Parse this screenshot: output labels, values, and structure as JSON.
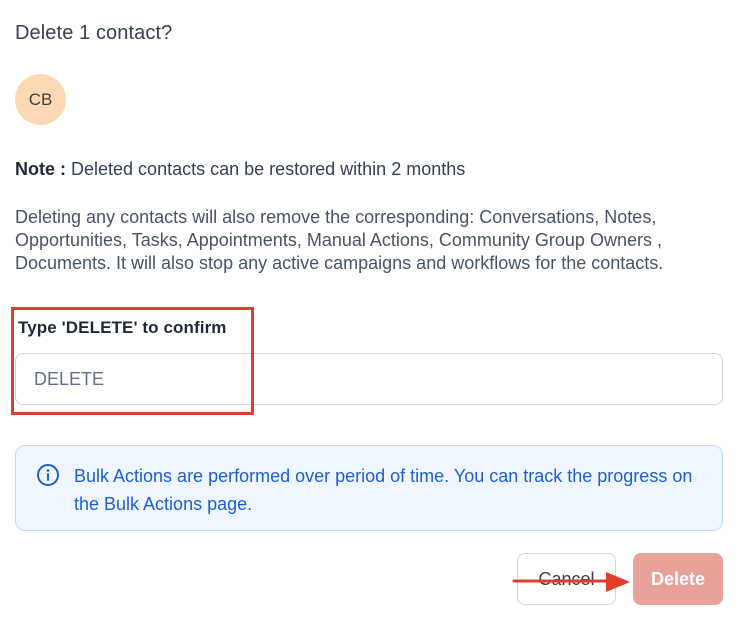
{
  "dialog": {
    "title": "Delete 1 contact?",
    "avatar_initials": "CB",
    "note_label": "Note :",
    "note_text": "Deleted contacts can be restored within 2 months",
    "warning_text": "Deleting any contacts will also remove the corresponding: Conversations, Notes, Opportunities, Tasks, Appointments, Manual Actions, Community Group Owners , Documents. It will also stop any active campaigns and workflows for the contacts.",
    "confirm_label": "Type 'DELETE' to confirm",
    "confirm_placeholder": "DELETE",
    "confirm_value": "",
    "info_icon": "info-circle-icon",
    "info_text": "Bulk Actions are performed over period of time. You can track the progress on the Bulk Actions page.",
    "cancel_label": "Cancel",
    "delete_label": "Delete"
  },
  "annotations": {
    "highlight_color": "#e03e2d",
    "arrow_color": "#e03e2d"
  },
  "colors": {
    "avatar_bg": "#fdd8b5",
    "info_bg": "#eff6ff",
    "info_text": "#1d5fd1",
    "delete_button_bg": "#e8a29a"
  }
}
